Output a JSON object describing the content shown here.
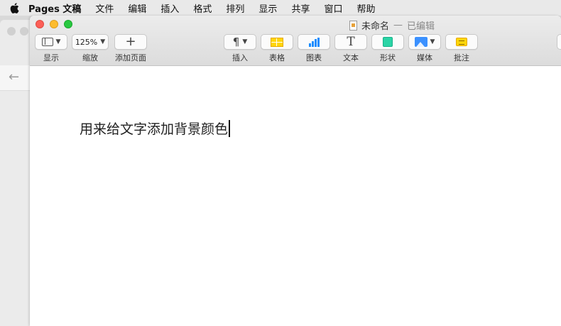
{
  "menubar": {
    "app_name": "Pages 文稿",
    "items": [
      "文件",
      "编辑",
      "插入",
      "格式",
      "排列",
      "显示",
      "共享",
      "窗口",
      "帮助"
    ]
  },
  "window": {
    "title": "未命名",
    "separator": "—",
    "status": "已编辑"
  },
  "toolbar": {
    "view_label": "显示",
    "zoom_value": "125%",
    "zoom_label": "缩放",
    "add_page_label": "添加页面",
    "insert_label": "插入",
    "table_label": "表格",
    "chart_label": "图表",
    "text_label": "文本",
    "shape_label": "形状",
    "media_label": "媒体",
    "comment_label": "批注"
  },
  "document": {
    "body_text": "用来给文字添加背景颜色"
  },
  "colors": {
    "close": "#fc5f57",
    "minimize": "#fdbc2e",
    "zoom": "#28c840",
    "table_icon": "#ffd60a",
    "chart_icon": "#1a8cff",
    "shape_icon": "#2bd4a6",
    "media_icon": "#3b91ff"
  }
}
